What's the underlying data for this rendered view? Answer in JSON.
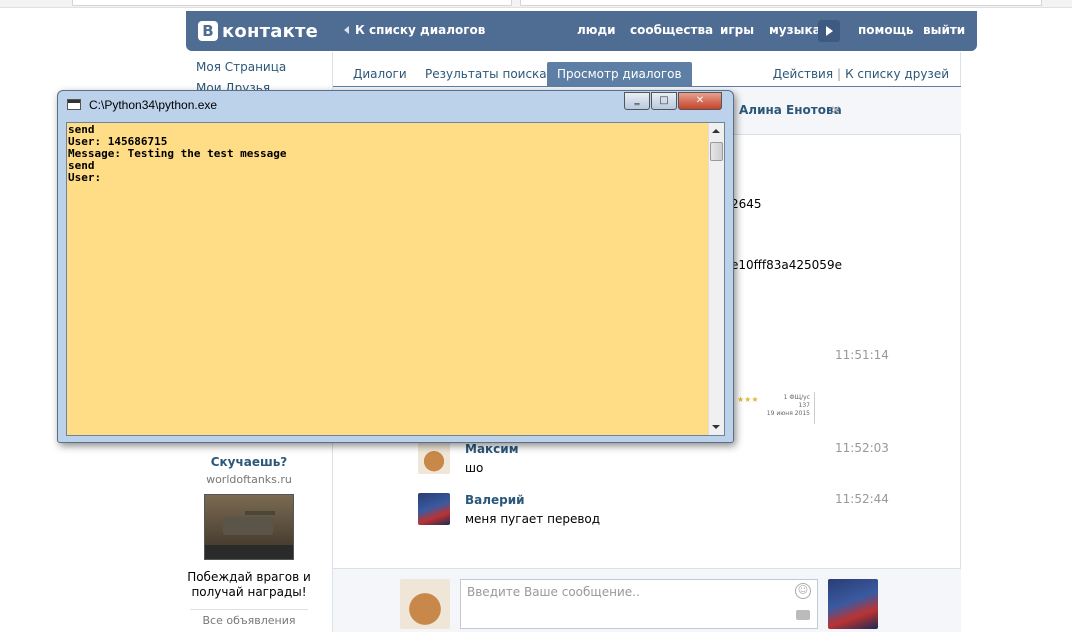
{
  "header": {
    "logo_text": "контакте",
    "logo_letter": "В",
    "back_link": "К списку диалогов",
    "nav": [
      "люди",
      "сообщества",
      "игры",
      "музыка"
    ],
    "help": "помощь",
    "logout": "выйти"
  },
  "left_menu": [
    "Моя Страница",
    "Мои Друзья"
  ],
  "ad": {
    "title": "Скучаешь?",
    "domain": "worldoftanks.ru",
    "text": "Побеждай врагов и получай награды!",
    "all_ads": "Все объявления"
  },
  "tabs": {
    "dialogs": "Диалоги",
    "search_results": "Результаты поиска",
    "view_dialogs": "Просмотр диалогов"
  },
  "actions": {
    "actions": "Действия",
    "sep": "|",
    "friends": "К списку друзей"
  },
  "dialog": {
    "name": "Алина Енотова",
    "close": "×"
  },
  "fragments": {
    "f1": "2645",
    "f2": "e10fff83a425059e",
    "t1": "11:51:14"
  },
  "widget": {
    "stars": "★★★",
    "line1": "1 ФЩ/ус",
    "line2": "137",
    "line3": "19 июня 2015"
  },
  "messages": [
    {
      "author": "Максим",
      "text": "шо",
      "time": "11:52:03"
    },
    {
      "author": "Валерий",
      "text": "меня пугает перевод",
      "time": "11:52:44"
    }
  ],
  "compose": {
    "placeholder": "Введите Ваше сообщение.."
  },
  "console": {
    "title": "C:\\Python34\\python.exe",
    "min": "‗",
    "max": "□",
    "close": "✕",
    "output": "send\nUser: 145686715\nMessage: Testing the test message\nsend\nUser:"
  }
}
